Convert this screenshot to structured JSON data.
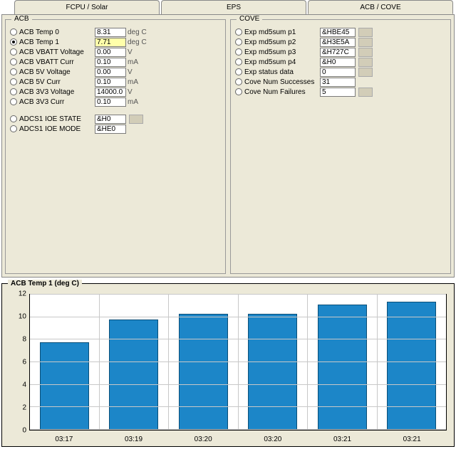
{
  "tabs": {
    "t0": "FCPU / Solar",
    "t1": "EPS",
    "t2": "ACB / COVE"
  },
  "acb": {
    "title": "ACB",
    "rows_a": [
      {
        "label": "ACB Temp 0",
        "value": "8.31",
        "unit": "deg C",
        "sel": false
      },
      {
        "label": "ACB Temp 1",
        "value": "7.71",
        "unit": "deg C",
        "sel": true,
        "hl": true
      },
      {
        "label": "ACB VBATT Voltage",
        "value": "0.00",
        "unit": "V",
        "sel": false
      },
      {
        "label": "ACB VBATT Curr",
        "value": "0.10",
        "unit": "mA",
        "sel": false
      },
      {
        "label": "ACB 5V Voltage",
        "value": "0.00",
        "unit": "V",
        "sel": false
      },
      {
        "label": "ACB 5V Curr",
        "value": "0.10",
        "unit": "mA",
        "sel": false
      },
      {
        "label": "ACB 3V3 Voltage",
        "value": "14000.0",
        "unit": "V",
        "sel": false
      },
      {
        "label": "ACB 3V3 Curr",
        "value": "0.10",
        "unit": "mA",
        "sel": false
      }
    ],
    "rows_b": [
      {
        "label": "ADCS1 IOE STATE",
        "value": "&H0",
        "unit": "",
        "sel": false,
        "swatch": true
      },
      {
        "label": "ADCS1 IOE MODE",
        "value": "&HE0",
        "unit": "",
        "sel": false
      }
    ]
  },
  "cove": {
    "title": "COVE",
    "rows": [
      {
        "label": "Exp md5sum p1",
        "value": "&HBE45",
        "swatch": true
      },
      {
        "label": "Exp md5sum p2",
        "value": "&H3E5A",
        "swatch": true
      },
      {
        "label": "Exp md5sum p3",
        "value": "&H727C",
        "swatch": true
      },
      {
        "label": "Exp md5sum p4",
        "value": "&H0",
        "swatch": true
      },
      {
        "label": "Exp status data",
        "value": "0",
        "swatch": true
      },
      {
        "label": "Cove Num Successes",
        "value": "31",
        "swatch": false
      },
      {
        "label": "Cove Num Failures",
        "value": "5",
        "swatch": true
      }
    ]
  },
  "chart_data": {
    "type": "bar",
    "title": "ACB Temp 1 (deg C)",
    "categories": [
      "03:17",
      "03:19",
      "03:20",
      "03:20",
      "03:21",
      "03:21"
    ],
    "values": [
      7.8,
      9.8,
      10.3,
      10.3,
      11.1,
      11.4
    ],
    "ylim": [
      0,
      12
    ],
    "yticks": [
      0,
      2,
      4,
      6,
      8,
      10,
      12
    ],
    "xlabel": "",
    "ylabel": ""
  }
}
